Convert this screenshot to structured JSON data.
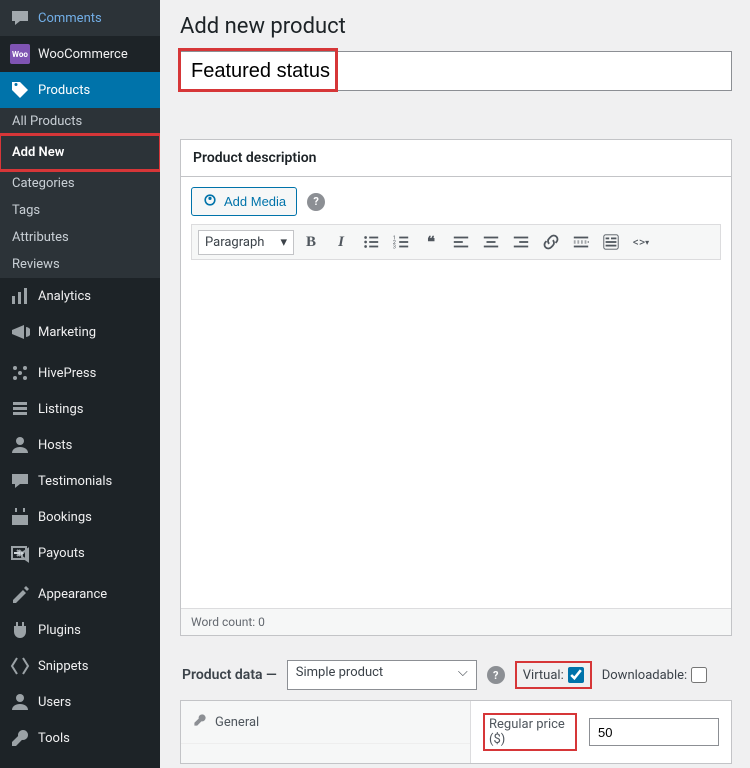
{
  "sidebar": {
    "top": [
      {
        "icon": "comment-icon",
        "label": "Comments"
      },
      {
        "icon": "woo-icon",
        "label": "WooCommerce"
      },
      {
        "icon": "tag-icon",
        "label": "Products",
        "active": true
      }
    ],
    "products_sub": [
      {
        "label": "All Products"
      },
      {
        "label": "Add New",
        "current": true,
        "highlight": true
      },
      {
        "label": "Categories"
      },
      {
        "label": "Tags"
      },
      {
        "label": "Attributes"
      },
      {
        "label": "Reviews"
      }
    ],
    "bottom": [
      {
        "icon": "analytics-icon",
        "label": "Analytics"
      },
      {
        "icon": "megaphone-icon",
        "label": "Marketing"
      }
    ],
    "group2": [
      {
        "icon": "hivepress-icon",
        "label": "HivePress"
      },
      {
        "icon": "listings-icon",
        "label": "Listings"
      },
      {
        "icon": "hosts-icon",
        "label": "Hosts"
      },
      {
        "icon": "testimonials-icon",
        "label": "Testimonials"
      },
      {
        "icon": "bookings-icon",
        "label": "Bookings"
      },
      {
        "icon": "payouts-icon",
        "label": "Payouts"
      }
    ],
    "group3": [
      {
        "icon": "appearance-icon",
        "label": "Appearance"
      },
      {
        "icon": "plugins-icon",
        "label": "Plugins"
      },
      {
        "icon": "snippets-icon",
        "label": "Snippets"
      },
      {
        "icon": "users-icon",
        "label": "Users"
      },
      {
        "icon": "tools-icon",
        "label": "Tools"
      }
    ]
  },
  "page": {
    "heading": "Add new product",
    "title_value": "Featured status"
  },
  "description_panel": {
    "header": "Product description",
    "add_media": "Add Media",
    "paragraph_dropdown": "Paragraph",
    "word_count": "Word count: 0"
  },
  "product_data": {
    "title": "Product data —",
    "type_value": "Simple product",
    "virtual_label": "Virtual:",
    "virtual_checked": true,
    "downloadable_label": "Downloadable:",
    "downloadable_checked": false,
    "tabs": {
      "general": "General"
    },
    "fields": {
      "regular_price_label": "Regular price ($)",
      "regular_price_value": "50"
    }
  }
}
